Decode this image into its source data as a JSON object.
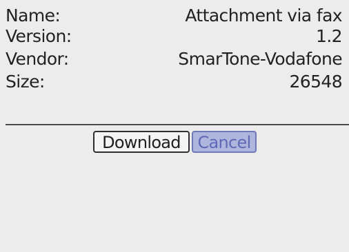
{
  "details": {
    "name_label": "Name:",
    "name_value": "Attachment via fax",
    "version_label": "Version:",
    "version_value": "1.2",
    "vendor_label": "Vendor:",
    "vendor_value": "SmarTone-Vodafone",
    "size_label": "Size:",
    "size_value": "26548"
  },
  "actions": {
    "download_label": "Download",
    "cancel_label": "Cancel"
  },
  "colors": {
    "background": "#ececec",
    "text": "#222222",
    "cancel_fill": "#aeb6de",
    "cancel_text": "#5f69b6"
  }
}
